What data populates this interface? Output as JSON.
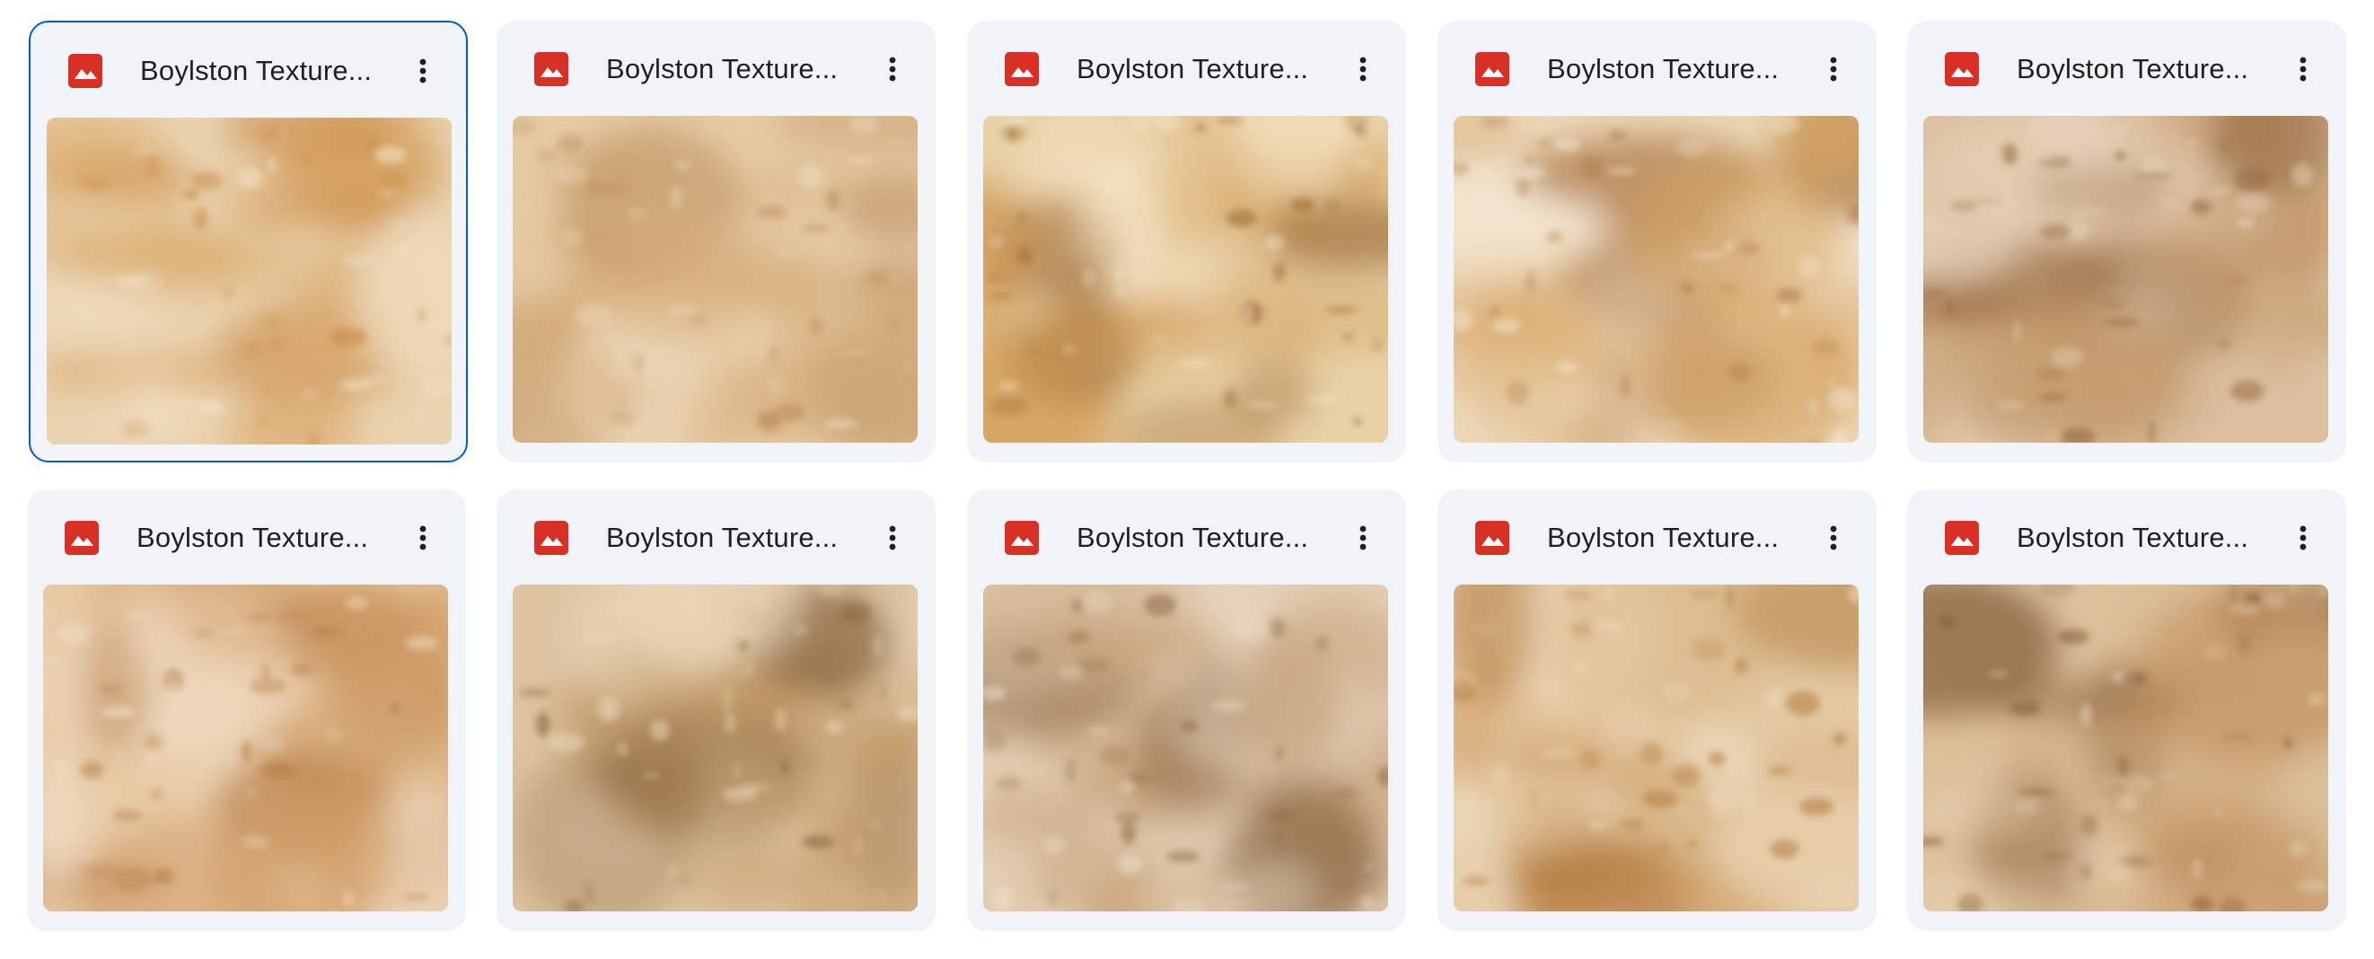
{
  "files": [
    {
      "name": "Boylston Texture...",
      "icon": "image-file-icon",
      "selected": true
    },
    {
      "name": "Boylston Texture...",
      "icon": "image-file-icon",
      "selected": false
    },
    {
      "name": "Boylston Texture...",
      "icon": "image-file-icon",
      "selected": false
    },
    {
      "name": "Boylston Texture...",
      "icon": "image-file-icon",
      "selected": false
    },
    {
      "name": "Boylston Texture...",
      "icon": "image-file-icon",
      "selected": false
    },
    {
      "name": "Boylston Texture...",
      "icon": "image-file-icon",
      "selected": false
    },
    {
      "name": "Boylston Texture...",
      "icon": "image-file-icon",
      "selected": false
    },
    {
      "name": "Boylston Texture...",
      "icon": "image-file-icon",
      "selected": false
    },
    {
      "name": "Boylston Texture...",
      "icon": "image-file-icon",
      "selected": false
    },
    {
      "name": "Boylston Texture...",
      "icon": "image-file-icon",
      "selected": false
    }
  ],
  "colors": {
    "card_bg": "#f0f4f9",
    "selected_border": "#0b57d0",
    "file_icon": "#d93025",
    "text": "#1f1f1f"
  }
}
